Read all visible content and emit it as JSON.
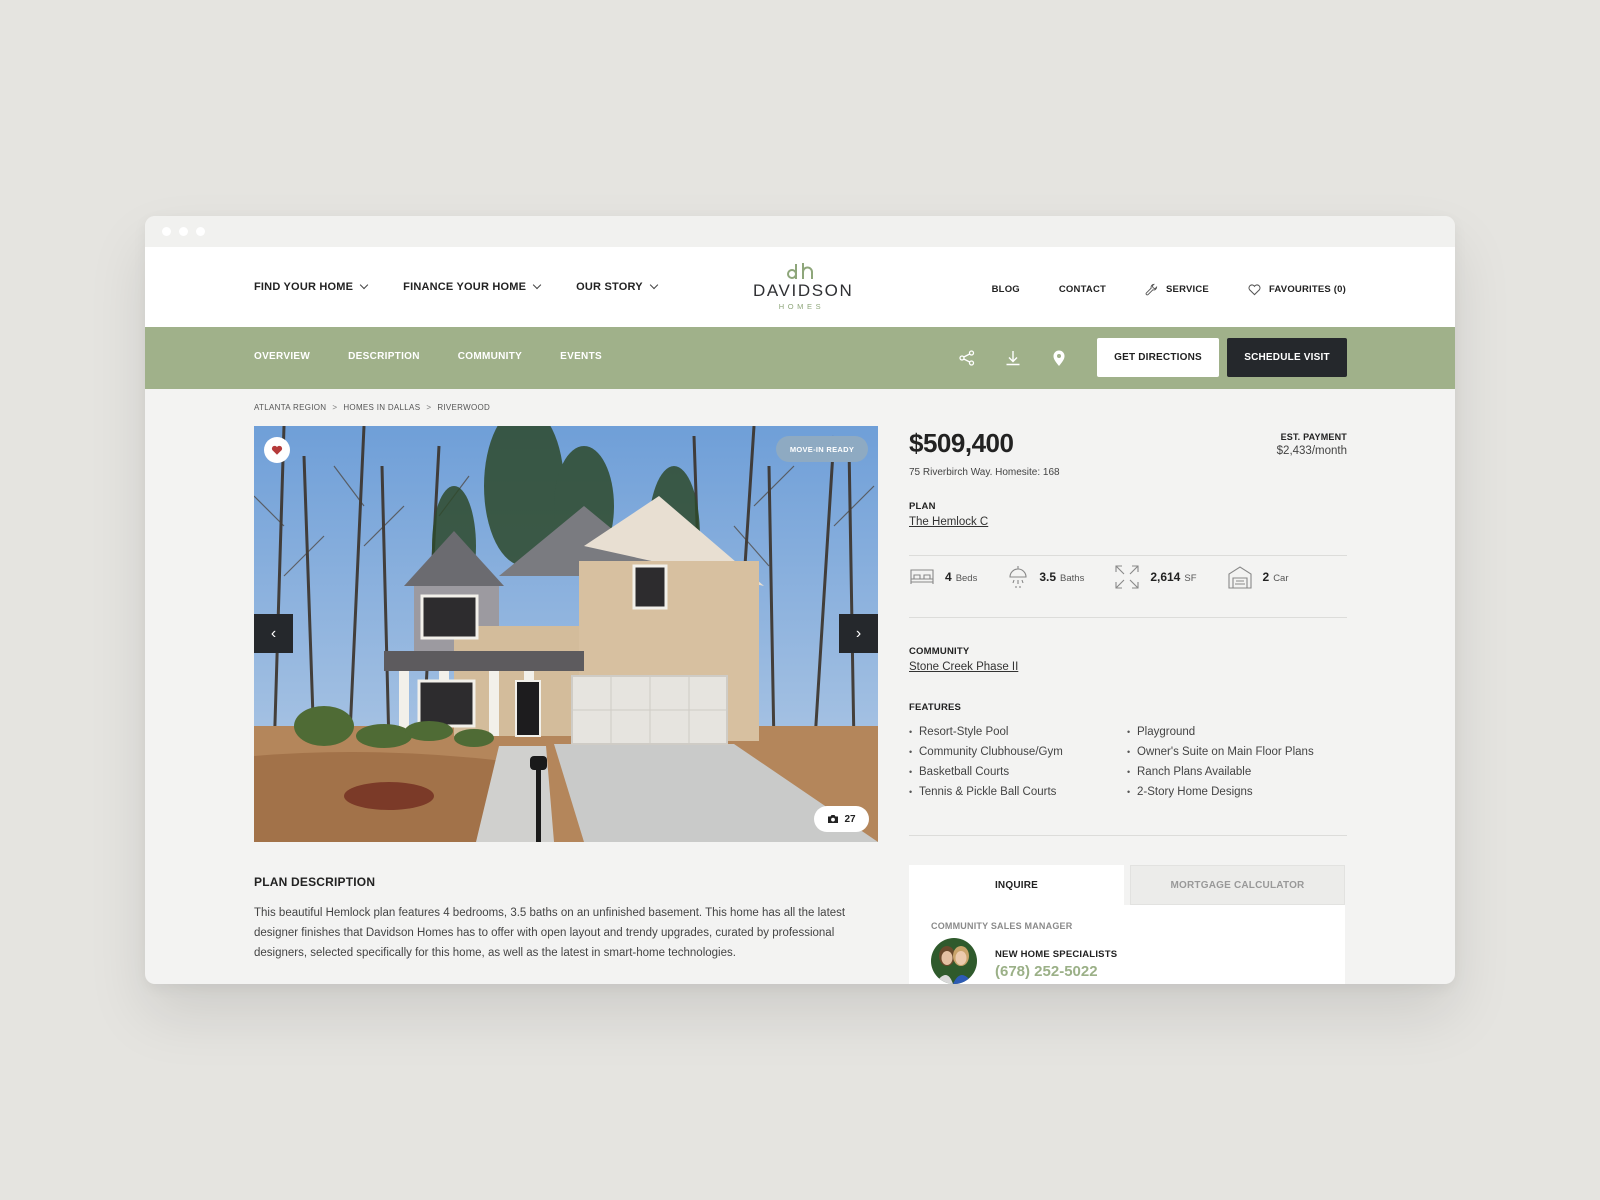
{
  "nav": {
    "left": [
      "FIND YOUR HOME",
      "FINANCE YOUR HOME",
      "OUR STORY"
    ],
    "right": {
      "blog": "BLOG",
      "contact": "CONTACT",
      "service": "SERVICE",
      "favourites": "FAVOURITES (0)"
    }
  },
  "logo": {
    "name": "DAVIDSON",
    "sub": "HOMES"
  },
  "subnav": {
    "tabs": [
      "OVERVIEW",
      "DESCRIPTION",
      "COMMUNITY",
      "EVENTS"
    ],
    "icons": [
      "share-icon",
      "download-icon",
      "map-pin-icon"
    ],
    "get_directions": "GET DIRECTIONS",
    "schedule_visit": "SCHEDULE VISIT"
  },
  "breadcrumb": [
    "ATLANTA REGION",
    "HOMES IN DALLAS",
    "RIVERWOOD"
  ],
  "gallery": {
    "badge": "MOVE-IN READY",
    "photo_count": "27",
    "prev": "‹",
    "next": "›"
  },
  "listing": {
    "price": "$509,400",
    "address": "75 Riverbirch Way. Homesite: 168",
    "est_payment_label": "EST. PAYMENT",
    "est_payment_value": "$2,433/month",
    "plan_label": "PLAN",
    "plan_name": "The Hemlock C",
    "specs": [
      {
        "icon": "bed-icon",
        "value": "4",
        "unit": "Beds"
      },
      {
        "icon": "shower-icon",
        "value": "3.5",
        "unit": "Baths"
      },
      {
        "icon": "expand-icon",
        "value": "2,614",
        "unit": "SF"
      },
      {
        "icon": "garage-icon",
        "value": "2",
        "unit": "Car"
      }
    ],
    "community_label": "COMMUNITY",
    "community_name": "Stone Creek Phase II",
    "features_label": "FEATURES",
    "features_left": [
      "Resort-Style Pool",
      "Community Clubhouse/Gym",
      "Basketball Courts",
      "Tennis & Pickle Ball Courts"
    ],
    "features_right": [
      "Playground",
      "Owner's Suite on Main Floor Plans",
      "Ranch Plans Available",
      "2-Story Home Designs"
    ]
  },
  "plan_description": {
    "title": "PLAN DESCRIPTION",
    "body": "This beautiful Hemlock plan features 4 bedrooms, 3.5 baths on an unfinished basement. This home has all the latest designer finishes that Davidson Homes has to offer with open layout and trendy upgrades, curated by professional designers, selected specifically for this home, as well as the latest in smart-home technologies."
  },
  "inquire": {
    "tab_inquire": "INQUIRE",
    "tab_mortgage": "MORTGAGE CALCULATOR",
    "manager_label": "COMMUNITY SALES MANAGER",
    "contact_name": "NEW HOME SPECIALISTS",
    "phone": "(678) 252-5022"
  },
  "colors": {
    "accent_green": "#a0b18a",
    "dark": "#25282c",
    "badge_blue": "#8eaac2",
    "favorite_red": "#b53a3a"
  }
}
